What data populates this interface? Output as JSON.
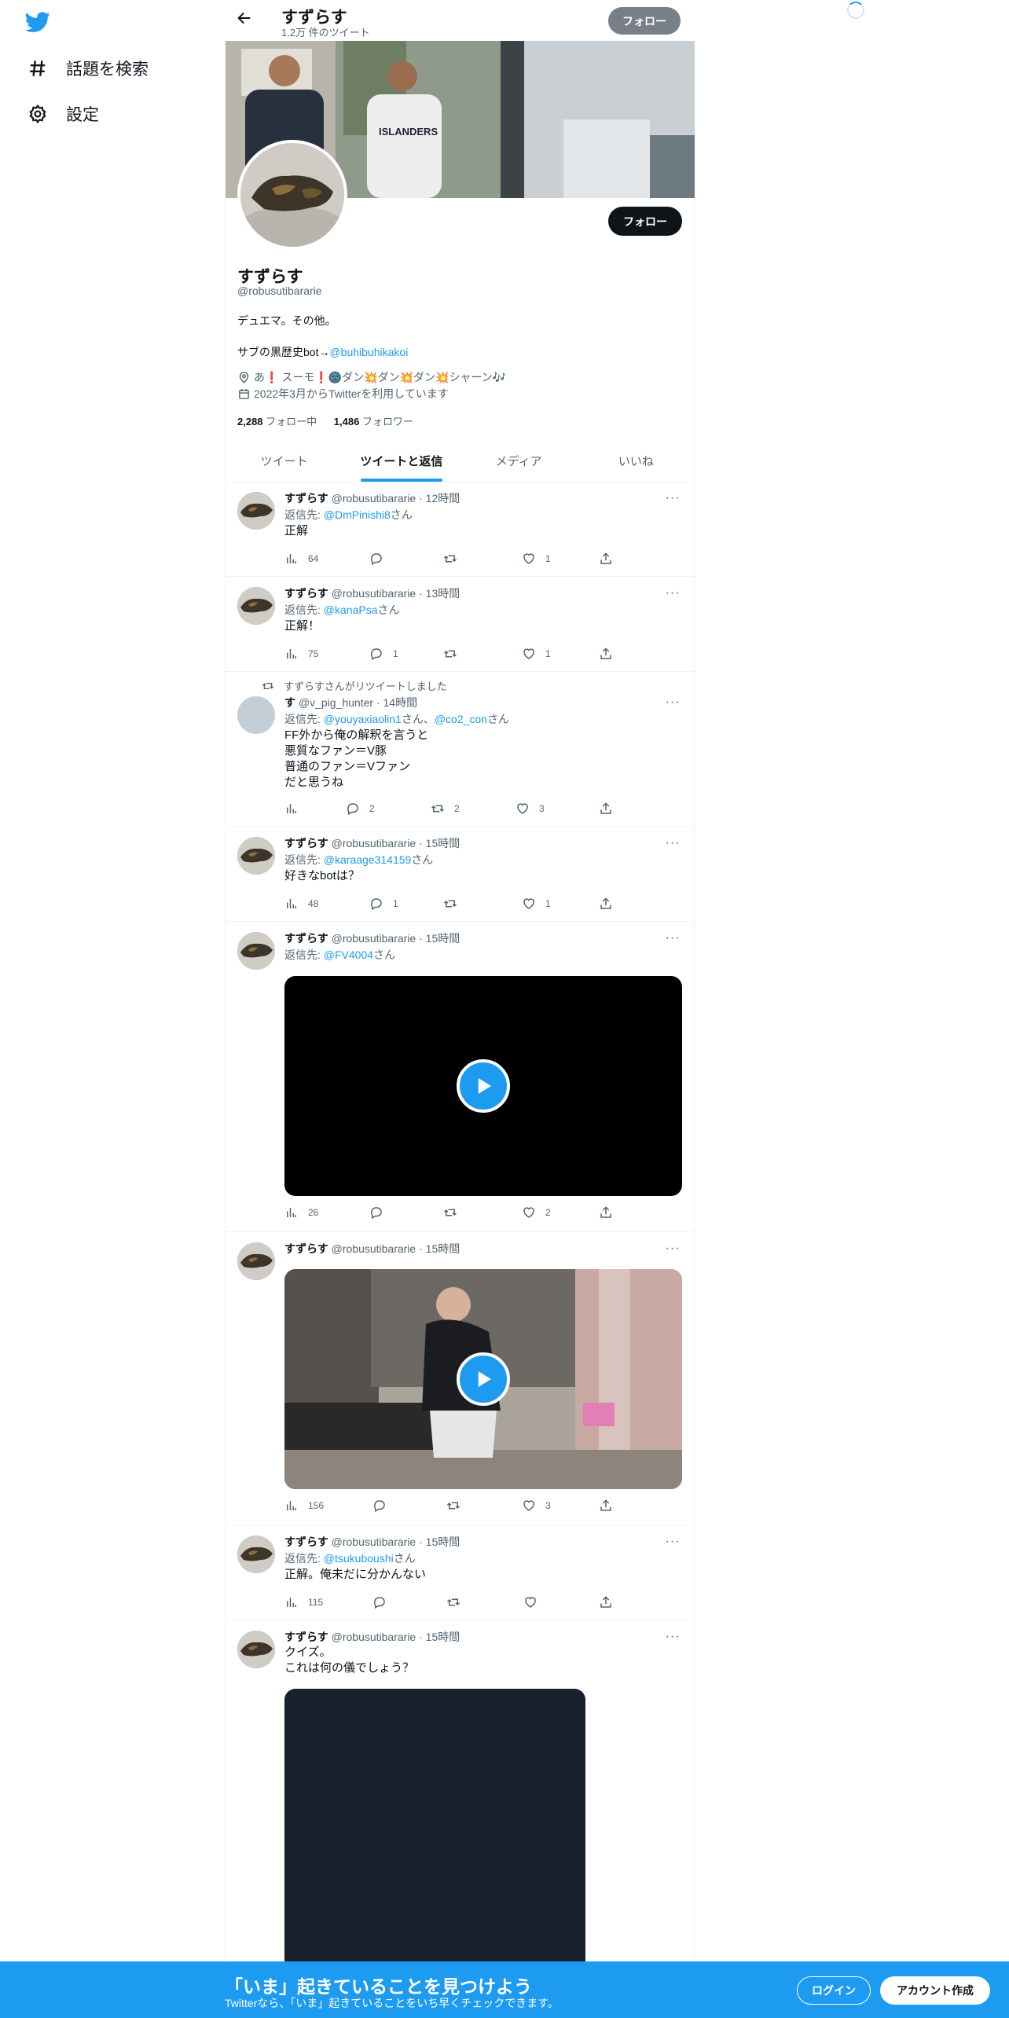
{
  "nav": {
    "items": [
      {
        "label": "話題を検索",
        "icon": "hashtag-icon"
      },
      {
        "label": "設定",
        "icon": "gear-icon"
      }
    ]
  },
  "header": {
    "title": "すずらす",
    "tweet_count": "1.2万 件のツイート",
    "follow_label": "フォロー"
  },
  "profile": {
    "follow_label": "フォロー",
    "name": "すずらす",
    "handle": "@robusutibararie",
    "bio_line1": "デュエマ。その他。",
    "bio_line2_prefix": "サブの黒歴史bot→",
    "bio_line2_link": "@buhibuhikakoi",
    "location": "あ❗ スーモ❗🌚ダン💥ダン💥ダン💥シャーン🎶",
    "joined": "2022年3月からTwitterを利用しています",
    "following_count": "2,288",
    "following_label": " フォロー中",
    "followers_count": "1,486",
    "followers_label": " フォロワー"
  },
  "tabs": [
    "ツイート",
    "ツイートと返信",
    "メディア",
    "いいね"
  ],
  "active_tab": 1,
  "tweets": [
    {
      "name": "すずらす",
      "meta": "@robusutibararie · 12時間",
      "reply_prefix": "返信先: ",
      "reply_to": "@DmPinishi8",
      "reply_suffix": "さん",
      "text": "正解",
      "views": "64",
      "replies": "",
      "retweets": "",
      "likes": "1"
    },
    {
      "name": "すずらす",
      "meta": "@robusutibararie · 13時間",
      "reply_prefix": "返信先: ",
      "reply_to": "@kanaPsa",
      "reply_suffix": "さん",
      "text": "正解！",
      "views": "75",
      "replies": "1",
      "retweets": "",
      "likes": "1"
    },
    {
      "retweet_label": "すずらすさんがリツイートしました",
      "name": "す",
      "meta": "@v_pig_hunter · 14時間",
      "reply_prefix": "返信先: ",
      "reply_to": "@youyaxiaolin1",
      "reply_mid": "さん、",
      "reply_to2": "@co2_con",
      "reply_suffix": "さん",
      "text_lines": [
        "FF外から俺の解釈を言うと",
        "悪質なファン＝V豚",
        "普通のファン＝Vファン",
        "だと思うね"
      ],
      "views": "",
      "replies": "2",
      "retweets": "2",
      "likes": "3"
    },
    {
      "name": "すずらす",
      "meta": "@robusutibararie · 15時間",
      "reply_prefix": "返信先: ",
      "reply_to": "@karaage314159",
      "reply_suffix": "さん",
      "text": "好きなbotは？",
      "views": "48",
      "replies": "1",
      "retweets": "",
      "likes": "1"
    },
    {
      "name": "すずらす",
      "meta": "@robusutibararie · 15時間",
      "reply_prefix": "返信先: ",
      "reply_to": "@FV4004",
      "reply_suffix": "さん",
      "views": "26",
      "replies": "",
      "retweets": "",
      "likes": "2"
    },
    {
      "name": "すずらす",
      "meta": "@robusutibararie · 15時間",
      "views": "156",
      "replies": "",
      "retweets": "",
      "likes": "3"
    },
    {
      "name": "すずらす",
      "meta": "@robusutibararie · 15時間",
      "reply_prefix": "返信先: ",
      "reply_to": "@tsukuboushi",
      "reply_suffix": "さん",
      "text": "正解。俺未だに分かんない",
      "views": "115",
      "replies": "",
      "retweets": "",
      "likes": ""
    },
    {
      "name": "すずらす",
      "meta": "@robusutibararie · 15時間",
      "text_lines": [
        "クイズ。",
        "これは何の儀でしょう？"
      ]
    }
  ],
  "bottom": {
    "title": "「いま」起きていることを見つけよう",
    "subtitle": "Twitterなら、「いま」起きていることをいち早くチェックできます。",
    "login": "ログイン",
    "signup": "アカウント作成"
  },
  "colors": {
    "accent": "#1d9bf0",
    "text": "#0f1419",
    "muted": "#536471"
  }
}
